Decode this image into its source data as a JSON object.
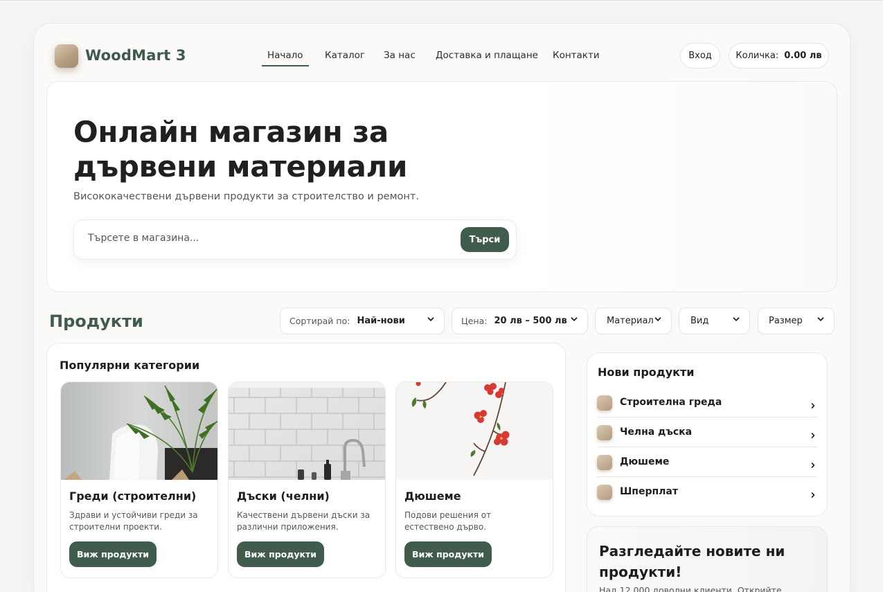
{
  "header": {
    "brand": "WoodMart 3",
    "nav": [
      "Начало",
      "Каталог",
      "За нас",
      "Доставка и плащане",
      "Контакти"
    ],
    "login_label": "Вход",
    "cart_label": "Количка:",
    "cart_total": "0.00 лв"
  },
  "hero": {
    "title": "Онлайн магазин за дървени материали",
    "subtitle": "Висококачествени дървени продукти за строителство и ремонт.",
    "search_placeholder": "Търсете в магазина...",
    "search_button": "Търси"
  },
  "products": {
    "title": "Продукти",
    "filters": {
      "sort_label": "Сортирай по:",
      "sort_value": "Най-нови",
      "price_label": "Цена:",
      "price_value": "20 лв – 500 лв",
      "material": "Материал",
      "type": "Вид",
      "size": "Размер"
    }
  },
  "categories": {
    "title": "Популярни категории",
    "items": [
      {
        "title": "Греди (строителни)",
        "desc": "Здрави и устойчиви греди за строителни проекти.",
        "button": "Виж продукти"
      },
      {
        "title": "Дъски (челни)",
        "desc": "Качествени дървени дъски за различни приложения.",
        "button": "Виж продукти"
      },
      {
        "title": "Дюшеме",
        "desc": "Подови решения от естествено дърво.",
        "button": "Виж продукти"
      }
    ]
  },
  "new_products": {
    "title": "Нови продукти",
    "items": [
      "Строителна греда",
      "Челна дъска",
      "Дюшеме",
      "Шперплат"
    ]
  },
  "promo": {
    "title": "Разгледайте новите ни продукти!",
    "text": "Над 12 000 доволни клиенти. Открийте"
  },
  "colors": {
    "accent": "#3f5c4d",
    "wood": "#b49c80",
    "background": "#f6f5f3"
  }
}
